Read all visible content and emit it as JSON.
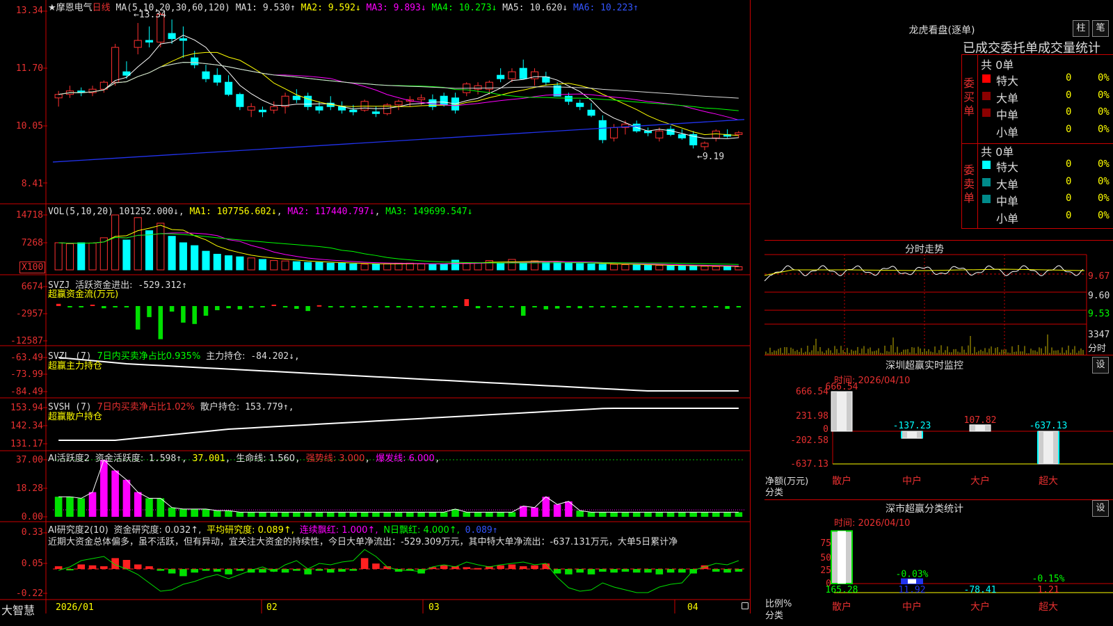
{
  "stock": {
    "name": "★摩恩电气",
    "period": "日线",
    "ma_header": "MA(5,10,20,30,60,120)",
    "ma1": "MA1: 9.530↑",
    "ma2": "MA2: 9.592↓",
    "ma3": "MA3: 9.893↓",
    "ma4": "MA4: 10.273↓",
    "ma5": "MA5: 10.620↓",
    "ma6": "MA6: 10.223↑",
    "high_label": "←13.34",
    "low_label": "←9.19",
    "price_ticks": [
      "13.34",
      "11.70",
      "10.05",
      "8.41"
    ]
  },
  "vol": {
    "header": "VOL(5,10,20)",
    "value": "101252.000↓",
    "ma1": "MA1: 107756.602↓",
    "ma2": "MA2: 117440.797↓",
    "ma3": "MA3: 149699.547↓",
    "ticks": [
      "14718",
      "7268"
    ],
    "unit": "X100"
  },
  "svzj": {
    "header": "SVZJ",
    "label": "活跃资金进出:",
    "value": "-529.312↑",
    "sub": "超赢资金流(万元)",
    "ticks": [
      "6674",
      "-2957",
      "-12587"
    ]
  },
  "svzl": {
    "header": "SVZL (7)",
    "label": "7日内买卖净占比0.935%",
    "label2": "主力持仓:",
    "value": "-84.202↓,",
    "sub": "超赢主力持仓",
    "ticks": [
      "-63.49",
      "-73.99",
      "-84.49"
    ]
  },
  "svsh": {
    "header": "SVSH (7)",
    "label": "7日内买卖净占比1.02%",
    "label2": "散户持仓:",
    "value": "153.779↑,",
    "sub": "超赢散户持仓",
    "ticks": [
      "153.94",
      "142.34",
      "131.17"
    ]
  },
  "ai_act": {
    "header": "AI活跃度2",
    "label": "资金活跃度:",
    "value": "1.598↑",
    "v2": "37.001",
    "life": "生命线: 1.560",
    "strong": "强势线: 3.000",
    "burst": "爆发线: 6.000",
    "ticks": [
      "37.00",
      "18.28",
      "0.00"
    ]
  },
  "ai_res": {
    "header": "AI研究度2(10)",
    "label": "资金研究度: 0.032↑,",
    "avg": "平均研究度: 0.089↑,",
    "red": "连续飘红: 1.000↑,",
    "nred": "N日飘红: 4.000↑,",
    "last": "0.089↑",
    "text": "近期大资金总体偏多，虽不活跃，但有异动，宜关注大资金的持续性，今日大单净流出：-529.309万元，其中特大单净流出：-637.131万元，大单5日累计净",
    "ticks": [
      "0.33",
      "0.05",
      "-0.22"
    ]
  },
  "bottom": {
    "logo": "大智慧",
    "dates": [
      "2026/01",
      "02",
      "03",
      "04"
    ]
  },
  "longhu": {
    "title": "龙虎看盘(逐单)",
    "btn1": "柱",
    "btn2": "笔",
    "header": "已成交委托单成交量统计",
    "buy_label": "委买单",
    "sell_label": "委卖单",
    "buy_total": "共 0单",
    "sell_total": "共 0单",
    "rows": [
      {
        "name": "特大",
        "val": "0",
        "pct": "0%"
      },
      {
        "name": "大单",
        "val": "0",
        "pct": "0%"
      },
      {
        "name": "中单",
        "val": "0",
        "pct": "0%"
      },
      {
        "name": "小单",
        "val": "0",
        "pct": "0%"
      }
    ],
    "buy_colors": [
      "#ff0000",
      "#8b0000",
      "#8b0000",
      "#000000"
    ],
    "sell_colors": [
      "#00ffff",
      "#008b8b",
      "#008b8b",
      "#000000"
    ]
  },
  "fenshi": {
    "title": "分时走势",
    "p1": "9.67",
    "p2": "9.60",
    "p3": "9.53",
    "vol": "3347",
    "unit": "分时"
  },
  "monitor": {
    "title": "深圳超赢实时监控",
    "btn": "设",
    "time": "时间: 2026/04/10",
    "ticks": [
      "666.54",
      "231.98",
      "0",
      "-202.58",
      "-637.13"
    ],
    "ylabel": "净额(万元)",
    "xlabel": "分类",
    "categories": [
      "散户",
      "中户",
      "大户",
      "超大"
    ],
    "labels": [
      "666.54",
      "-137.23",
      "107.82",
      "-637.13"
    ]
  },
  "fenlei": {
    "title": "深市超赢分类统计",
    "btn": "设",
    "time": "时间: 2026/04/10",
    "ticks": [
      "75",
      "50",
      "25",
      "0"
    ],
    "ylabel": "比例%",
    "xlabel": "分类",
    "categories": [
      "散户",
      "中户",
      "大户",
      "超大"
    ],
    "top_labels": [
      "",
      "-0.03%",
      "",
      "-0.15%"
    ],
    "bottom_labels": [
      "165.28",
      "11.92",
      "-78.41",
      "1.21"
    ]
  },
  "chart_data": [
    {
      "type": "candlestick",
      "title": "摩恩电气 日线",
      "ylim": [
        8.41,
        13.34
      ],
      "candles": [
        [
          10.85,
          11.05,
          10.6,
          10.95
        ],
        [
          10.95,
          11.2,
          10.85,
          11.05
        ],
        [
          11.05,
          11.15,
          10.9,
          11.0
        ],
        [
          11.0,
          11.2,
          10.9,
          11.1
        ],
        [
          11.1,
          11.35,
          11.0,
          11.3
        ],
        [
          11.3,
          12.4,
          11.2,
          12.3
        ],
        [
          11.6,
          11.9,
          11.4,
          11.5
        ],
        [
          12.3,
          13.0,
          12.1,
          12.5
        ],
        [
          12.5,
          12.9,
          12.3,
          12.45
        ],
        [
          12.45,
          13.3,
          12.3,
          13.25
        ],
        [
          12.7,
          13.1,
          12.4,
          12.55
        ],
        [
          12.55,
          12.9,
          12.0,
          12.5
        ],
        [
          12.0,
          12.2,
          11.7,
          11.8
        ],
        [
          11.6,
          11.8,
          11.3,
          11.4
        ],
        [
          11.5,
          11.7,
          11.2,
          11.3
        ],
        [
          11.3,
          11.5,
          10.9,
          10.95
        ],
        [
          10.95,
          11.0,
          10.5,
          10.6
        ],
        [
          10.5,
          10.7,
          10.3,
          10.6
        ],
        [
          10.5,
          10.6,
          10.3,
          10.45
        ],
        [
          10.5,
          10.75,
          10.4,
          10.6
        ],
        [
          10.6,
          11.0,
          10.4,
          10.9
        ],
        [
          10.9,
          11.1,
          10.7,
          10.8
        ],
        [
          10.9,
          11.0,
          10.5,
          10.6
        ],
        [
          10.6,
          10.75,
          10.4,
          10.5
        ],
        [
          10.7,
          10.9,
          10.5,
          10.6
        ],
        [
          10.6,
          10.75,
          10.4,
          10.5
        ],
        [
          10.5,
          10.65,
          10.35,
          10.45
        ],
        [
          10.5,
          10.8,
          10.45,
          10.75
        ],
        [
          10.45,
          10.6,
          10.3,
          10.4
        ],
        [
          10.4,
          10.7,
          10.35,
          10.65
        ],
        [
          10.65,
          10.8,
          10.5,
          10.75
        ],
        [
          10.75,
          10.9,
          10.6,
          10.8
        ],
        [
          10.8,
          10.95,
          10.65,
          10.85
        ],
        [
          10.8,
          10.95,
          10.5,
          10.6
        ],
        [
          10.9,
          11.0,
          10.6,
          10.65
        ],
        [
          10.85,
          11.0,
          10.4,
          10.5
        ],
        [
          11.0,
          11.3,
          10.9,
          11.25
        ],
        [
          11.1,
          11.3,
          10.95,
          11.2
        ],
        [
          11.1,
          11.35,
          10.95,
          11.3
        ],
        [
          11.5,
          11.7,
          11.3,
          11.4
        ],
        [
          11.4,
          11.7,
          11.3,
          11.6
        ],
        [
          11.7,
          11.95,
          11.5,
          11.4
        ],
        [
          11.4,
          11.7,
          11.2,
          11.6
        ],
        [
          11.45,
          11.6,
          11.2,
          11.3
        ],
        [
          11.2,
          11.3,
          10.9,
          10.9
        ],
        [
          10.9,
          11.0,
          10.65,
          10.75
        ],
        [
          10.7,
          10.8,
          10.5,
          10.6
        ],
        [
          10.5,
          10.7,
          10.3,
          10.35
        ],
        [
          10.2,
          10.35,
          9.55,
          9.65
        ],
        [
          9.7,
          10.1,
          9.6,
          10.0
        ],
        [
          10.0,
          10.2,
          9.8,
          10.1
        ],
        [
          10.1,
          10.2,
          9.85,
          9.9
        ],
        [
          9.9,
          10.0,
          9.75,
          9.85
        ],
        [
          9.7,
          10.0,
          9.6,
          9.9
        ],
        [
          9.95,
          10.05,
          9.75,
          9.8
        ],
        [
          9.8,
          9.95,
          9.65,
          9.7
        ],
        [
          9.8,
          9.9,
          9.4,
          9.5
        ],
        [
          9.45,
          9.6,
          9.35,
          9.55
        ],
        [
          9.7,
          9.95,
          9.6,
          9.9
        ],
        [
          9.8,
          9.95,
          9.7,
          9.75
        ],
        [
          9.8,
          9.9,
          9.7,
          9.85
        ]
      ]
    }
  ]
}
